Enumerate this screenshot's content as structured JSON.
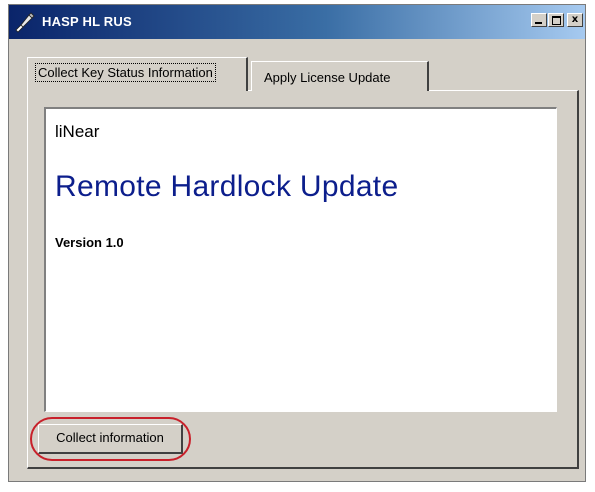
{
  "window": {
    "title": "HASP HL RUS",
    "controls": {
      "minimize_icon": "minimize-icon",
      "maximize_icon": "maximize-icon",
      "close_label": "x"
    }
  },
  "tabs": [
    {
      "label": "Collect Key Status Information",
      "active": true
    },
    {
      "label": "Apply License Update",
      "active": false
    }
  ],
  "info": {
    "vendor": "liNear",
    "product": "Remote Hardlock Update",
    "version": "Version 1.0"
  },
  "actions": {
    "collect_label": "Collect information"
  },
  "colors": {
    "title_gradient_start": "#0a246a",
    "title_gradient_end": "#a6caf0",
    "product_text": "#0c1e8c",
    "highlight_ring": "#c8202a",
    "window_face": "#d4d0c8"
  }
}
